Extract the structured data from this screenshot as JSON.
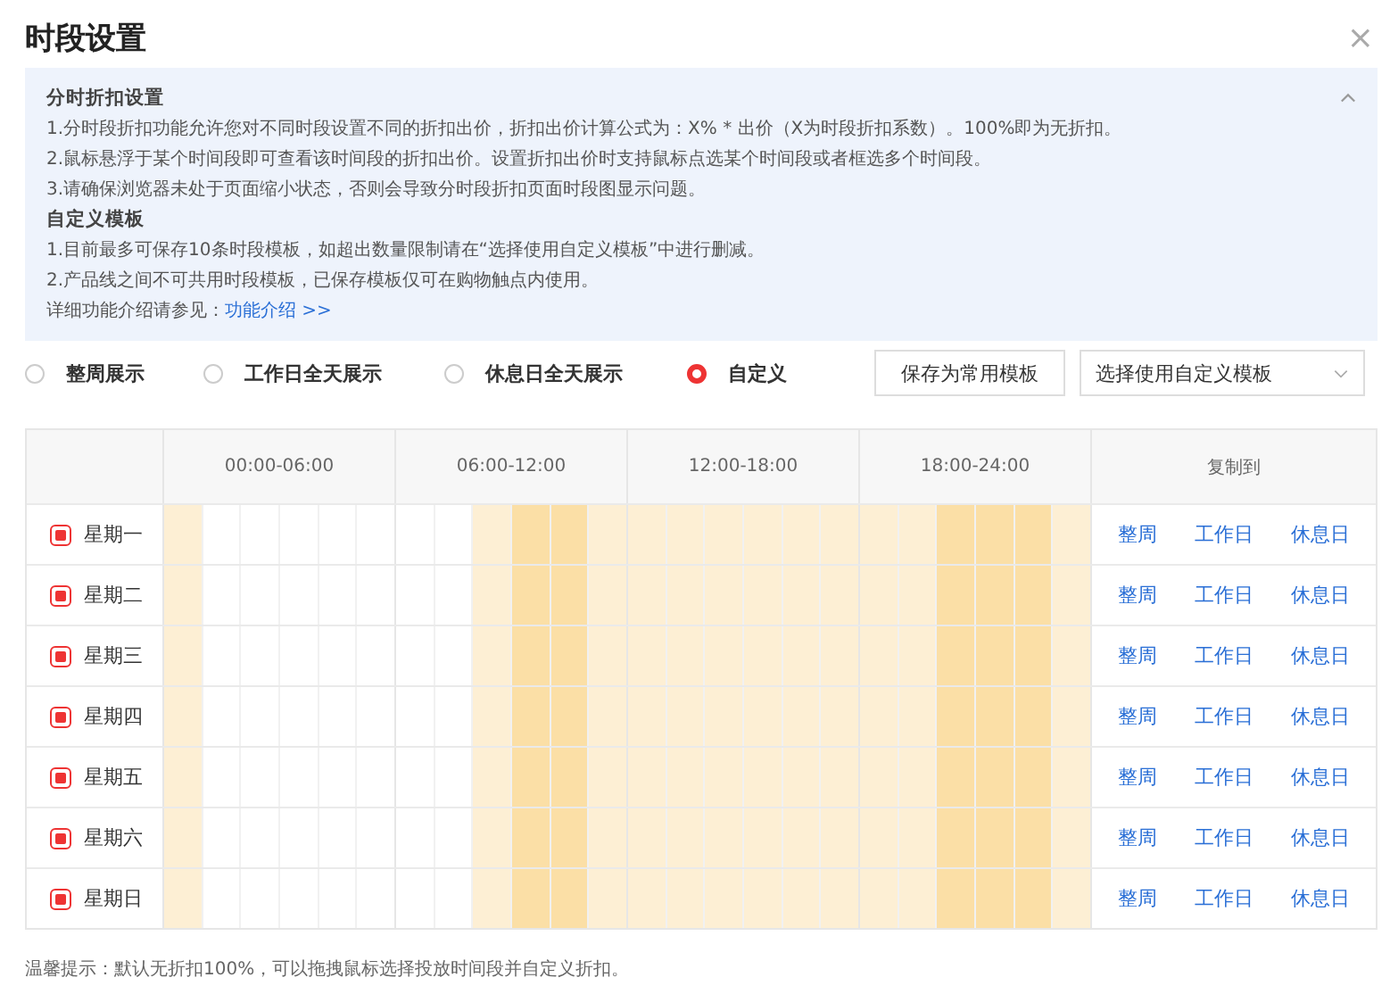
{
  "dialog": {
    "title": "时段设置",
    "close_icon": "×"
  },
  "info": {
    "expanded": true,
    "sections": [
      {
        "heading": "分时折扣设置",
        "lines": [
          "1.分时段折扣功能允许您对不同时段设置不同的折扣出价，折扣出价计算公式为：X% * 出价（X为时段折扣系数）。100%即为无折扣。",
          "2.鼠标悬浮于某个时间段即可查看该时间段的折扣出价。设置折扣出价时支持鼠标点选某个时间段或者框选多个时间段。",
          "3.请确保浏览器未处于页面缩小状态，否则会导致分时段折扣页面时段图显示问题。"
        ]
      },
      {
        "heading": "自定义模板",
        "lines": [
          "1.目前最多可保存10条时段模板，如超出数量限制请在“选择使用自定义模板”中进行删减。",
          "2.产品线之间不可共用时段模板，已保存模板仅可在购物触点内使用。"
        ]
      }
    ],
    "more": {
      "text": "详细功能介绍请参见：",
      "link": "功能介绍 >>"
    }
  },
  "modes": [
    {
      "label": "整周展示",
      "selected": false
    },
    {
      "label": "工作日全天展示",
      "selected": false
    },
    {
      "label": "休息日全天展示",
      "selected": false
    },
    {
      "label": "自定义",
      "selected": true
    }
  ],
  "save_button": "保存为常用模板",
  "template_select": {
    "placeholder": "选择使用自定义模板"
  },
  "table": {
    "columns": [
      "00:00-06:00",
      "06:00-12:00",
      "12:00-18:00",
      "18:00-24:00",
      "复制到"
    ],
    "rows": [
      {
        "day": "星期一",
        "checked": true,
        "copy_links": [
          "整周",
          "工作日",
          "休息日"
        ],
        "cells": [
          {
            "color": "#fdefd4"
          },
          {
            "color": "#ffffff"
          },
          {
            "color": "#ffffff"
          },
          {
            "color": "#ffffff"
          },
          {
            "color": "#ffffff"
          },
          {
            "color": "#ffffff"
          },
          {
            "color": "#ffffff"
          },
          {
            "color": "#ffffff"
          },
          {
            "color": "#fdefd4"
          },
          {
            "color": "#fbdfa6"
          },
          {
            "color": "#fbdfa6"
          },
          {
            "color": "#fdefd4"
          },
          {
            "color": "#fdefd4"
          },
          {
            "color": "#fdefd4"
          },
          {
            "color": "#fdefd4"
          },
          {
            "color": "#fdefd4"
          },
          {
            "color": "#fdefd4"
          },
          {
            "color": "#fdefd4"
          },
          {
            "color": "#fdefd4"
          },
          {
            "color": "#fdefd4"
          },
          {
            "color": "#fbdfa6"
          },
          {
            "color": "#fbdfa6"
          },
          {
            "color": "#fbdfa6"
          },
          {
            "color": "#fdefd4"
          }
        ]
      },
      {
        "day": "星期二",
        "checked": true,
        "copy_links": [
          "整周",
          "工作日",
          "休息日"
        ],
        "cells": [
          {
            "color": "#fdefd4"
          },
          {
            "color": "#ffffff"
          },
          {
            "color": "#ffffff"
          },
          {
            "color": "#ffffff"
          },
          {
            "color": "#ffffff"
          },
          {
            "color": "#ffffff"
          },
          {
            "color": "#ffffff"
          },
          {
            "color": "#ffffff"
          },
          {
            "color": "#fdefd4"
          },
          {
            "color": "#fbdfa6"
          },
          {
            "color": "#fbdfa6"
          },
          {
            "color": "#fdefd4"
          },
          {
            "color": "#fdefd4"
          },
          {
            "color": "#fdefd4"
          },
          {
            "color": "#fdefd4"
          },
          {
            "color": "#fdefd4"
          },
          {
            "color": "#fdefd4"
          },
          {
            "color": "#fdefd4"
          },
          {
            "color": "#fdefd4"
          },
          {
            "color": "#fdefd4"
          },
          {
            "color": "#fbdfa6"
          },
          {
            "color": "#fbdfa6"
          },
          {
            "color": "#fbdfa6"
          },
          {
            "color": "#fdefd4"
          }
        ]
      },
      {
        "day": "星期三",
        "checked": true,
        "copy_links": [
          "整周",
          "工作日",
          "休息日"
        ],
        "cells": [
          {
            "color": "#fdefd4"
          },
          {
            "color": "#ffffff"
          },
          {
            "color": "#ffffff"
          },
          {
            "color": "#ffffff"
          },
          {
            "color": "#ffffff"
          },
          {
            "color": "#ffffff"
          },
          {
            "color": "#ffffff"
          },
          {
            "color": "#ffffff"
          },
          {
            "color": "#fdefd4"
          },
          {
            "color": "#fbdfa6"
          },
          {
            "color": "#fbdfa6"
          },
          {
            "color": "#fdefd4"
          },
          {
            "color": "#fdefd4"
          },
          {
            "color": "#fdefd4"
          },
          {
            "color": "#fdefd4"
          },
          {
            "color": "#fdefd4"
          },
          {
            "color": "#fdefd4"
          },
          {
            "color": "#fdefd4"
          },
          {
            "color": "#fdefd4"
          },
          {
            "color": "#fdefd4"
          },
          {
            "color": "#fbdfa6"
          },
          {
            "color": "#fbdfa6"
          },
          {
            "color": "#fbdfa6"
          },
          {
            "color": "#fdefd4"
          }
        ]
      },
      {
        "day": "星期四",
        "checked": true,
        "copy_links": [
          "整周",
          "工作日",
          "休息日"
        ],
        "cells": [
          {
            "color": "#fdefd4"
          },
          {
            "color": "#ffffff"
          },
          {
            "color": "#ffffff"
          },
          {
            "color": "#ffffff"
          },
          {
            "color": "#ffffff"
          },
          {
            "color": "#ffffff"
          },
          {
            "color": "#ffffff"
          },
          {
            "color": "#ffffff"
          },
          {
            "color": "#fdefd4"
          },
          {
            "color": "#fbdfa6"
          },
          {
            "color": "#fbdfa6"
          },
          {
            "color": "#fdefd4"
          },
          {
            "color": "#fdefd4"
          },
          {
            "color": "#fdefd4"
          },
          {
            "color": "#fdefd4"
          },
          {
            "color": "#fdefd4"
          },
          {
            "color": "#fdefd4"
          },
          {
            "color": "#fdefd4"
          },
          {
            "color": "#fdefd4"
          },
          {
            "color": "#fdefd4"
          },
          {
            "color": "#fbdfa6"
          },
          {
            "color": "#fbdfa6"
          },
          {
            "color": "#fbdfa6"
          },
          {
            "color": "#fdefd4"
          }
        ]
      },
      {
        "day": "星期五",
        "checked": true,
        "copy_links": [
          "整周",
          "工作日",
          "休息日"
        ],
        "cells": [
          {
            "color": "#fdefd4"
          },
          {
            "color": "#ffffff"
          },
          {
            "color": "#ffffff"
          },
          {
            "color": "#ffffff"
          },
          {
            "color": "#ffffff"
          },
          {
            "color": "#ffffff"
          },
          {
            "color": "#ffffff"
          },
          {
            "color": "#ffffff"
          },
          {
            "color": "#fdefd4"
          },
          {
            "color": "#fbdfa6"
          },
          {
            "color": "#fbdfa6"
          },
          {
            "color": "#fdefd4"
          },
          {
            "color": "#fdefd4"
          },
          {
            "color": "#fdefd4"
          },
          {
            "color": "#fdefd4"
          },
          {
            "color": "#fdefd4"
          },
          {
            "color": "#fdefd4"
          },
          {
            "color": "#fdefd4"
          },
          {
            "color": "#fdefd4"
          },
          {
            "color": "#fdefd4"
          },
          {
            "color": "#fbdfa6"
          },
          {
            "color": "#fbdfa6"
          },
          {
            "color": "#fbdfa6"
          },
          {
            "color": "#fdefd4"
          }
        ]
      },
      {
        "day": "星期六",
        "checked": true,
        "copy_links": [
          "整周",
          "工作日",
          "休息日"
        ],
        "cells": [
          {
            "color": "#fdefd4"
          },
          {
            "color": "#ffffff"
          },
          {
            "color": "#ffffff"
          },
          {
            "color": "#ffffff"
          },
          {
            "color": "#ffffff"
          },
          {
            "color": "#ffffff"
          },
          {
            "color": "#ffffff"
          },
          {
            "color": "#ffffff"
          },
          {
            "color": "#fdefd4"
          },
          {
            "color": "#fbdfa6"
          },
          {
            "color": "#fbdfa6"
          },
          {
            "color": "#fdefd4"
          },
          {
            "color": "#fdefd4"
          },
          {
            "color": "#fdefd4"
          },
          {
            "color": "#fdefd4"
          },
          {
            "color": "#fdefd4"
          },
          {
            "color": "#fdefd4"
          },
          {
            "color": "#fdefd4"
          },
          {
            "color": "#fdefd4"
          },
          {
            "color": "#fdefd4"
          },
          {
            "color": "#fbdfa6"
          },
          {
            "color": "#fbdfa6"
          },
          {
            "color": "#fbdfa6"
          },
          {
            "color": "#fdefd4"
          }
        ]
      },
      {
        "day": "星期日",
        "checked": true,
        "copy_links": [
          "整周",
          "工作日",
          "休息日"
        ],
        "cells": [
          {
            "color": "#fdefd4"
          },
          {
            "color": "#ffffff"
          },
          {
            "color": "#ffffff"
          },
          {
            "color": "#ffffff"
          },
          {
            "color": "#ffffff"
          },
          {
            "color": "#ffffff"
          },
          {
            "color": "#ffffff"
          },
          {
            "color": "#ffffff"
          },
          {
            "color": "#fdefd4"
          },
          {
            "color": "#fbdfa6"
          },
          {
            "color": "#fbdfa6"
          },
          {
            "color": "#fdefd4"
          },
          {
            "color": "#fdefd4"
          },
          {
            "color": "#fdefd4"
          },
          {
            "color": "#fdefd4"
          },
          {
            "color": "#fdefd4"
          },
          {
            "color": "#fdefd4"
          },
          {
            "color": "#fdefd4"
          },
          {
            "color": "#fdefd4"
          },
          {
            "color": "#fdefd4"
          },
          {
            "color": "#fbdfa6"
          },
          {
            "color": "#fbdfa6"
          },
          {
            "color": "#fbdfa6"
          },
          {
            "color": "#fdefd4"
          }
        ]
      }
    ]
  },
  "tip": "温馨提示：默认无折扣100%，可以拖拽鼠标选择投放时间段并自定义折扣。"
}
